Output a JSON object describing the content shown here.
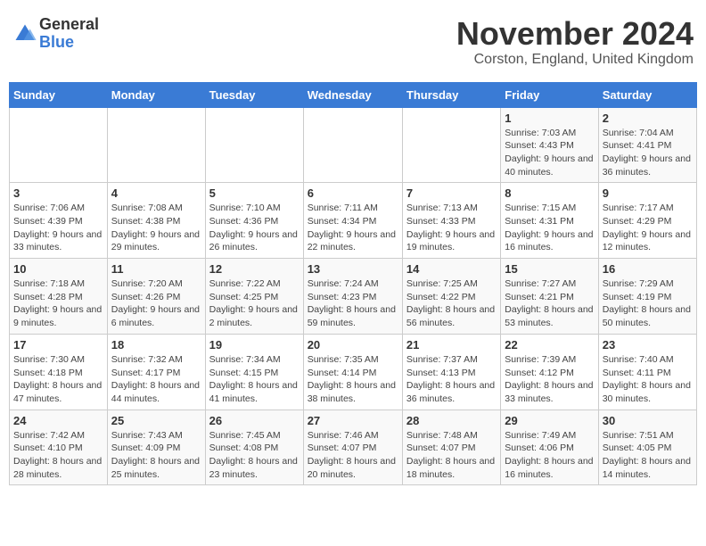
{
  "logo": {
    "general": "General",
    "blue": "Blue"
  },
  "header": {
    "month": "November 2024",
    "location": "Corston, England, United Kingdom"
  },
  "weekdays": [
    "Sunday",
    "Monday",
    "Tuesday",
    "Wednesday",
    "Thursday",
    "Friday",
    "Saturday"
  ],
  "weeks": [
    [
      {
        "day": "",
        "info": ""
      },
      {
        "day": "",
        "info": ""
      },
      {
        "day": "",
        "info": ""
      },
      {
        "day": "",
        "info": ""
      },
      {
        "day": "",
        "info": ""
      },
      {
        "day": "1",
        "info": "Sunrise: 7:03 AM\nSunset: 4:43 PM\nDaylight: 9 hours and 40 minutes."
      },
      {
        "day": "2",
        "info": "Sunrise: 7:04 AM\nSunset: 4:41 PM\nDaylight: 9 hours and 36 minutes."
      }
    ],
    [
      {
        "day": "3",
        "info": "Sunrise: 7:06 AM\nSunset: 4:39 PM\nDaylight: 9 hours and 33 minutes."
      },
      {
        "day": "4",
        "info": "Sunrise: 7:08 AM\nSunset: 4:38 PM\nDaylight: 9 hours and 29 minutes."
      },
      {
        "day": "5",
        "info": "Sunrise: 7:10 AM\nSunset: 4:36 PM\nDaylight: 9 hours and 26 minutes."
      },
      {
        "day": "6",
        "info": "Sunrise: 7:11 AM\nSunset: 4:34 PM\nDaylight: 9 hours and 22 minutes."
      },
      {
        "day": "7",
        "info": "Sunrise: 7:13 AM\nSunset: 4:33 PM\nDaylight: 9 hours and 19 minutes."
      },
      {
        "day": "8",
        "info": "Sunrise: 7:15 AM\nSunset: 4:31 PM\nDaylight: 9 hours and 16 minutes."
      },
      {
        "day": "9",
        "info": "Sunrise: 7:17 AM\nSunset: 4:29 PM\nDaylight: 9 hours and 12 minutes."
      }
    ],
    [
      {
        "day": "10",
        "info": "Sunrise: 7:18 AM\nSunset: 4:28 PM\nDaylight: 9 hours and 9 minutes."
      },
      {
        "day": "11",
        "info": "Sunrise: 7:20 AM\nSunset: 4:26 PM\nDaylight: 9 hours and 6 minutes."
      },
      {
        "day": "12",
        "info": "Sunrise: 7:22 AM\nSunset: 4:25 PM\nDaylight: 9 hours and 2 minutes."
      },
      {
        "day": "13",
        "info": "Sunrise: 7:24 AM\nSunset: 4:23 PM\nDaylight: 8 hours and 59 minutes."
      },
      {
        "day": "14",
        "info": "Sunrise: 7:25 AM\nSunset: 4:22 PM\nDaylight: 8 hours and 56 minutes."
      },
      {
        "day": "15",
        "info": "Sunrise: 7:27 AM\nSunset: 4:21 PM\nDaylight: 8 hours and 53 minutes."
      },
      {
        "day": "16",
        "info": "Sunrise: 7:29 AM\nSunset: 4:19 PM\nDaylight: 8 hours and 50 minutes."
      }
    ],
    [
      {
        "day": "17",
        "info": "Sunrise: 7:30 AM\nSunset: 4:18 PM\nDaylight: 8 hours and 47 minutes."
      },
      {
        "day": "18",
        "info": "Sunrise: 7:32 AM\nSunset: 4:17 PM\nDaylight: 8 hours and 44 minutes."
      },
      {
        "day": "19",
        "info": "Sunrise: 7:34 AM\nSunset: 4:15 PM\nDaylight: 8 hours and 41 minutes."
      },
      {
        "day": "20",
        "info": "Sunrise: 7:35 AM\nSunset: 4:14 PM\nDaylight: 8 hours and 38 minutes."
      },
      {
        "day": "21",
        "info": "Sunrise: 7:37 AM\nSunset: 4:13 PM\nDaylight: 8 hours and 36 minutes."
      },
      {
        "day": "22",
        "info": "Sunrise: 7:39 AM\nSunset: 4:12 PM\nDaylight: 8 hours and 33 minutes."
      },
      {
        "day": "23",
        "info": "Sunrise: 7:40 AM\nSunset: 4:11 PM\nDaylight: 8 hours and 30 minutes."
      }
    ],
    [
      {
        "day": "24",
        "info": "Sunrise: 7:42 AM\nSunset: 4:10 PM\nDaylight: 8 hours and 28 minutes."
      },
      {
        "day": "25",
        "info": "Sunrise: 7:43 AM\nSunset: 4:09 PM\nDaylight: 8 hours and 25 minutes."
      },
      {
        "day": "26",
        "info": "Sunrise: 7:45 AM\nSunset: 4:08 PM\nDaylight: 8 hours and 23 minutes."
      },
      {
        "day": "27",
        "info": "Sunrise: 7:46 AM\nSunset: 4:07 PM\nDaylight: 8 hours and 20 minutes."
      },
      {
        "day": "28",
        "info": "Sunrise: 7:48 AM\nSunset: 4:07 PM\nDaylight: 8 hours and 18 minutes."
      },
      {
        "day": "29",
        "info": "Sunrise: 7:49 AM\nSunset: 4:06 PM\nDaylight: 8 hours and 16 minutes."
      },
      {
        "day": "30",
        "info": "Sunrise: 7:51 AM\nSunset: 4:05 PM\nDaylight: 8 hours and 14 minutes."
      }
    ]
  ]
}
